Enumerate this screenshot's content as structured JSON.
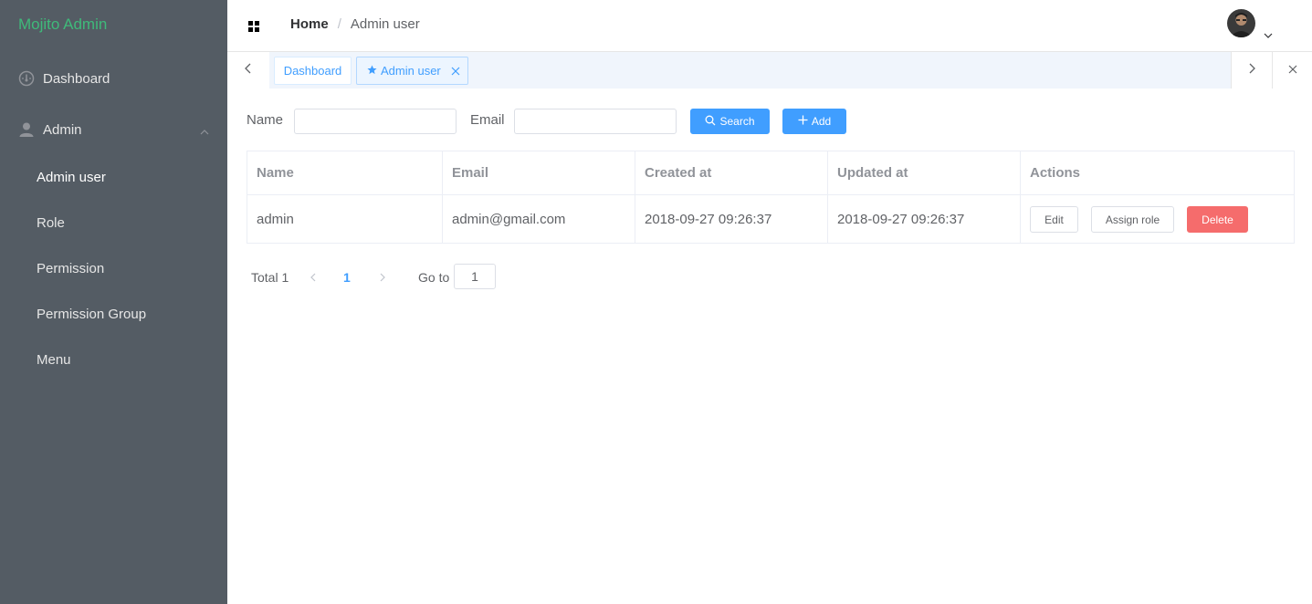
{
  "brand": "Mojito Admin",
  "sidebar": {
    "dashboard_label": "Dashboard",
    "admin_label": "Admin",
    "sub_items": [
      "Admin user",
      "Role",
      "Permission",
      "Permission Group",
      "Menu"
    ],
    "active_sub_item": "Admin user"
  },
  "header": {
    "breadcrumb_home": "Home",
    "breadcrumb_separator": "/",
    "breadcrumb_current": "Admin user"
  },
  "tags": {
    "dashboard_tag": "Dashboard",
    "current_tag": "Admin user"
  },
  "filters": {
    "name_label": "Name",
    "name_value": "",
    "email_label": "Email",
    "email_value": "",
    "search_label": "Search",
    "add_label": "Add"
  },
  "table": {
    "columns": [
      "Name",
      "Email",
      "Created at",
      "Updated at",
      "Actions"
    ],
    "rows": [
      {
        "name": "admin",
        "email": "admin@gmail.com",
        "created_at": "2018-09-27 09:26:37",
        "updated_at": "2018-09-27 09:26:37",
        "actions": {
          "edit": "Edit",
          "assign_role": "Assign role",
          "delete": "Delete"
        }
      }
    ]
  },
  "pagination": {
    "total_label": "Total 1",
    "current_page": "1",
    "goto_label": "Go to",
    "goto_value": "1"
  },
  "colors": {
    "sidebar_bg": "#545c64",
    "brand": "#3fba7a",
    "primary": "#409eff",
    "danger": "#f56c6c"
  }
}
